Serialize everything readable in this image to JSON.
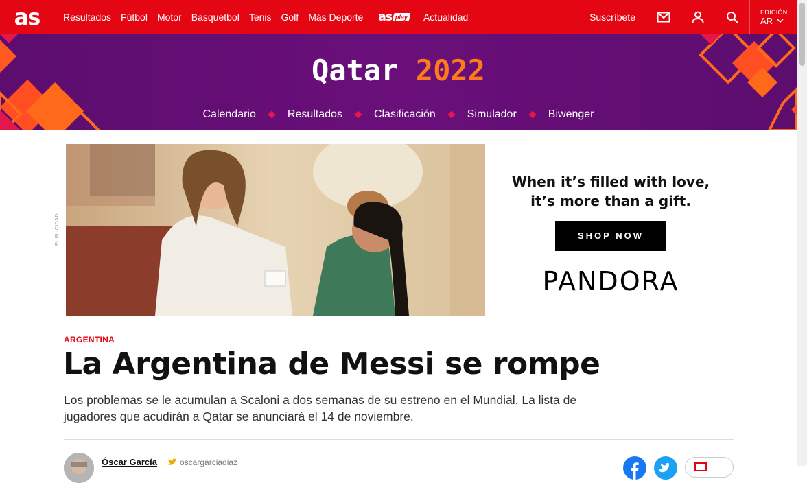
{
  "topnav": {
    "logo": "as",
    "links": [
      "Resultados",
      "Fútbol",
      "Motor",
      "Básquetbol",
      "Tenis",
      "Golf",
      "Más Deporte"
    ],
    "asplay_logo": "as",
    "asplay_tag": "play",
    "after_links": [
      "Actualidad"
    ],
    "subscribe": "Suscríbete",
    "edition_label": "EDICIÓN",
    "edition_value": "AR",
    "icons": [
      "mail-icon",
      "user-icon",
      "search-icon",
      "chevron-down-icon"
    ],
    "brand_color": "#e40613"
  },
  "banner": {
    "title_word": "Qatar",
    "title_year": "2022",
    "subnav": [
      "Calendario",
      "Resultados",
      "Clasificación",
      "Simulador",
      "Biwenger"
    ],
    "bg_color": "#5c0d6e",
    "accent_color": "#ff7a1a"
  },
  "ad": {
    "label": "PUBLICIDAD",
    "line1": "When it’s filled with love,",
    "line2": "it’s more than a gift.",
    "cta": "SHOP NOW",
    "brand": "PANDORA"
  },
  "article": {
    "kicker": "ARGENTINA",
    "headline": "La Argentina de Messi se rompe",
    "lede": "Los problemas se le acumulan a Scaloni a dos semanas de su estreno en el Mundial. La lista de jugadores que acudirán a Qatar se anunciará el 14 de noviembre.",
    "author": "Óscar García",
    "twitter_handle": "oscargarciadiaz",
    "share_icons": [
      "facebook-icon",
      "twitter-icon",
      "comment-icon"
    ]
  }
}
